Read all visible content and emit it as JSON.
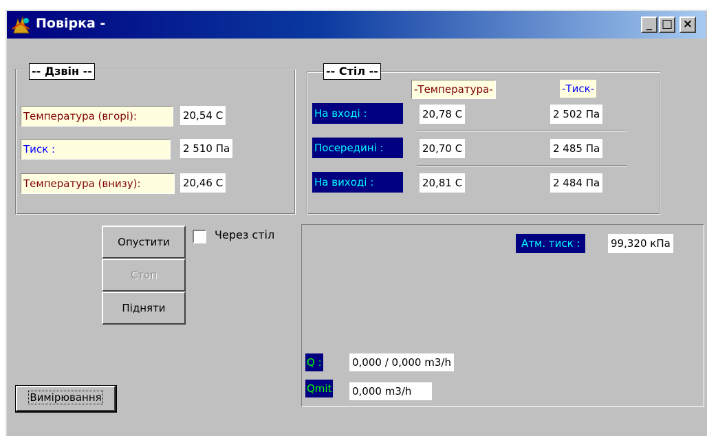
{
  "window": {
    "title": "Повірка  -",
    "icon": "app-icon",
    "controls": {
      "minimize": "_",
      "maximize": "□",
      "close": "×"
    }
  },
  "bell": {
    "legend": "-- Дзвін --",
    "rows": [
      {
        "label": "Температура (вгорі):",
        "value": "20,54 C"
      },
      {
        "label": "Тиск :",
        "value": "2 510 Па"
      },
      {
        "label": "Температура (внизу):",
        "value": "20,46 C"
      }
    ]
  },
  "table": {
    "legend": "-- Стіл --",
    "col_temp": "-Температура-",
    "col_pressure": "-Тиск-",
    "rows": [
      {
        "label": "На вході :",
        "temp": "20,78 C",
        "pressure": "2 502 Па"
      },
      {
        "label": "Посередині :",
        "temp": "20,70 C",
        "pressure": "2 485 Па"
      },
      {
        "label": "На виході :",
        "temp": "20,81 C",
        "pressure": "2 484 Па"
      }
    ]
  },
  "controls": {
    "lower": "Опустити",
    "stop": "Стоп",
    "raise": "Підняти",
    "through_table": "Через стіл",
    "through_table_checked": false,
    "measurement": "Вимірювання"
  },
  "atm": {
    "label": "Атм. тиск :",
    "value": "99,320 кПа"
  },
  "flow": {
    "q_label": "Q :",
    "q_value": "0,000  /  0,000  m3/h",
    "qmit_label": "Qmit",
    "qmit_value": "0,000  m3/h"
  }
}
